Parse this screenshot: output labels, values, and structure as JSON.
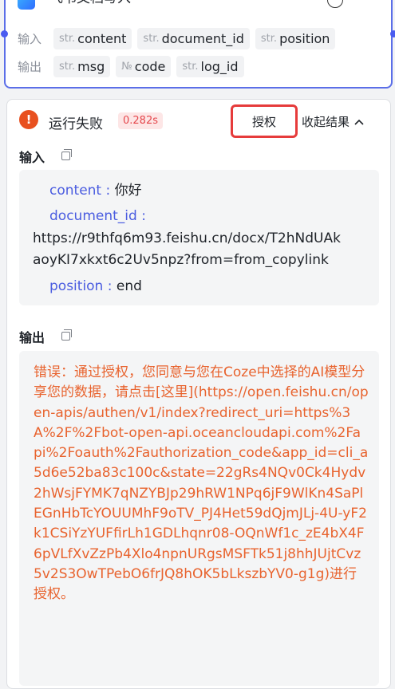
{
  "node": {
    "title": "飞书文档写入",
    "params": {
      "input_label": "输入",
      "output_label": "输出",
      "inputs": [
        {
          "type": "str.",
          "name": "content"
        },
        {
          "type": "str.",
          "name": "document_id"
        },
        {
          "type": "str.",
          "name": "position"
        }
      ],
      "outputs": [
        {
          "type": "str.",
          "name": "msg"
        },
        {
          "type": "№",
          "name": "code"
        },
        {
          "type": "str.",
          "name": "log_id"
        }
      ]
    }
  },
  "result": {
    "status": "运行失败",
    "duration": "0.282s",
    "authorize_label": "授权",
    "collapse_label": "收起结果",
    "input_section": {
      "title": "输入",
      "content_key": "content",
      "content_value": "你好",
      "document_id_key": "document_id",
      "document_id_value_line1": "https://r9thfq6m93.feishu.cn/docx/T2hNdUAk",
      "document_id_value_line2": "aoyKI7xkxt6c2Uv5npz?from=from_copylink",
      "position_key": "position",
      "position_value": "end"
    },
    "output_section": {
      "title": "输出",
      "error_text": "错误：通过授权，您同意与您在Coze中选择的AI模型分享您的数据，请点击[这里](https://open.feishu.cn/open-apis/authen/v1/index?redirect_uri=https%3A%2F%2Fbot-open-api.oceancloudapi.com%2Fapi%2Foauth%2Fauthorization_code&app_id=cli_a5d6e52ba83c100c&state=22gRs4NQv0Ck4Hydv2hWsjFYMK7qNZYBJp29hRW1NPq6jF9WlKn4SaPlEGnHbTcYOUUMhF9oTV_PJ4Het59dQjmJLj-4U-yF2k1CSiYzYUFfirLh1GDLhqnr08-OQnWf1c_zE4bX4F6pVLfXvZzPb4Xlo4npnURgsMSFTk51j8hhJUjtCvz5v2S3OwTPebO6frJQ8hOK5bLkszbYV0-g1g)进行授权。"
    }
  },
  "colors": {
    "accent": "#4a5ce0",
    "error": "#e8632e",
    "highlight_border": "#e63b3b"
  }
}
